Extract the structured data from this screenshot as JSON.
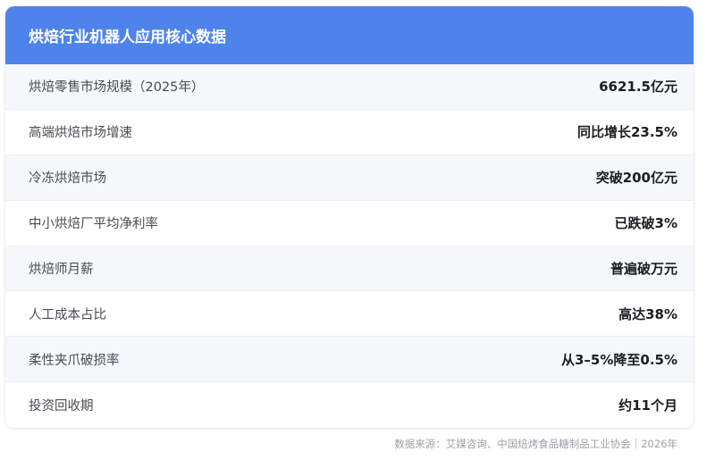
{
  "header": {
    "title": "烘焙行业机器人应用核心数据"
  },
  "rows": [
    {
      "label": "烘焙零售市场规模（2025年）",
      "value": "6621.5亿元"
    },
    {
      "label": "高端烘焙市场增速",
      "value": "同比增长23.5%"
    },
    {
      "label": "冷冻烘焙市场",
      "value": "突破200亿元"
    },
    {
      "label": "中小烘焙厂平均净利率",
      "value": "已跌破3%"
    },
    {
      "label": "烘焙师月薪",
      "value": "普遍破万元"
    },
    {
      "label": "人工成本占比",
      "value": "高达38%"
    },
    {
      "label": "柔性夹爪破损率",
      "value": "从3–5%降至0.5%"
    },
    {
      "label": "投资回收期",
      "value": "约11个月"
    }
  ],
  "footer": {
    "source": "数据来源：艾媒咨询、中国焙烤食品糖制品工业协会｜2026年"
  },
  "colors": {
    "header_bg": "#4f83ec",
    "row_alt_bg": "#f5f7fa"
  }
}
